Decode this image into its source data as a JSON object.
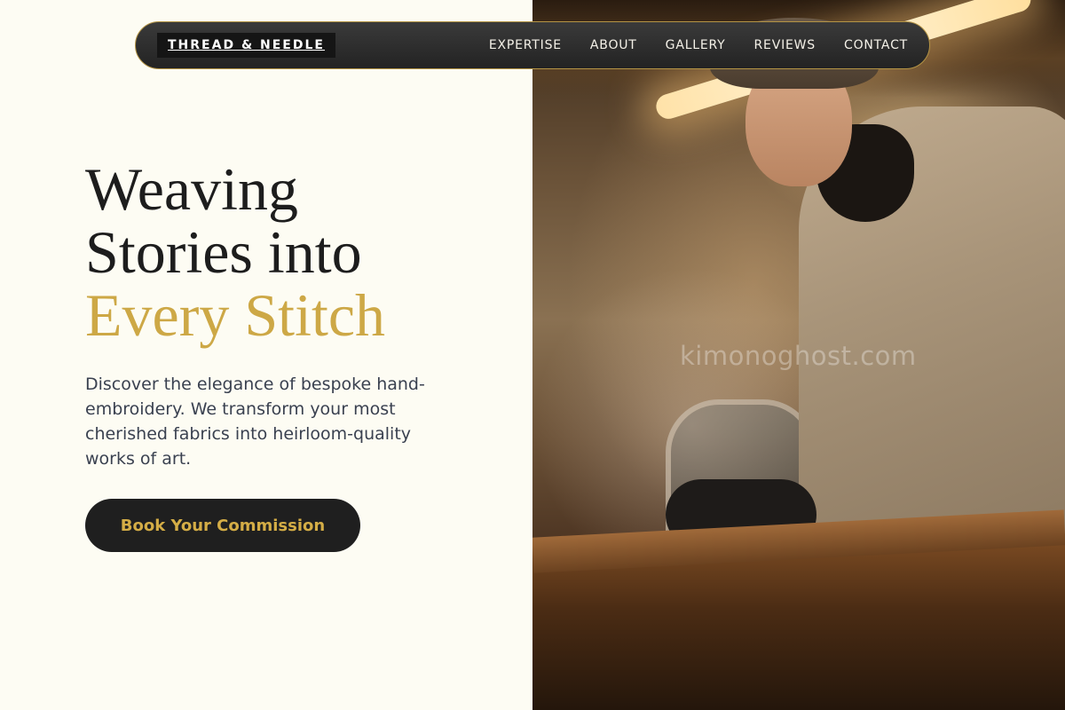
{
  "nav": {
    "brand": "THREAD & NEEDLE",
    "links": [
      "EXPERTISE",
      "ABOUT",
      "GALLERY",
      "REVIEWS",
      "CONTACT"
    ]
  },
  "hero": {
    "headline_line1": "Weaving",
    "headline_line2": "Stories into",
    "headline_accent": "Every Stitch",
    "description": "Discover the elegance of bespoke hand-embroidery. We transform your most cherished fabrics into heirloom-quality works of art.",
    "cta_label": "Book Your Commission"
  },
  "photo": {
    "watermark": "kimonoghost.com"
  },
  "colors": {
    "background": "#fdfcf3",
    "accent_gold": "#cda846",
    "nav_dark": "#2b2b2b",
    "text_dark": "#1d1d1d",
    "text_body": "#3a4150"
  }
}
